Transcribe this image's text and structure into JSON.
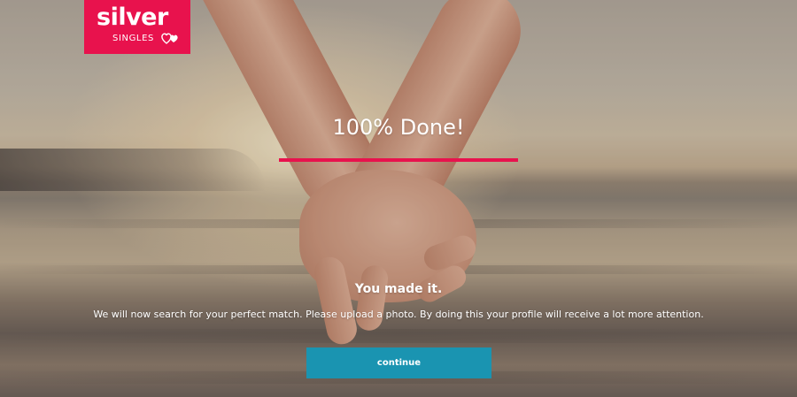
{
  "logo": {
    "word": "silver",
    "sub": "SINGLES"
  },
  "progress": {
    "title": "100% Done!",
    "percent": 100
  },
  "message": {
    "headline": "You made it.",
    "body": "We will now search for your perfect match. Please upload a photo. By doing this your profile will receive a lot more attention."
  },
  "actions": {
    "continue_label": "continue"
  },
  "colors": {
    "brand": "#e8124d",
    "button": "#1a94b1",
    "text": "#ffffff"
  },
  "background": {
    "subject": "holding-hands-at-sunset-photo"
  }
}
